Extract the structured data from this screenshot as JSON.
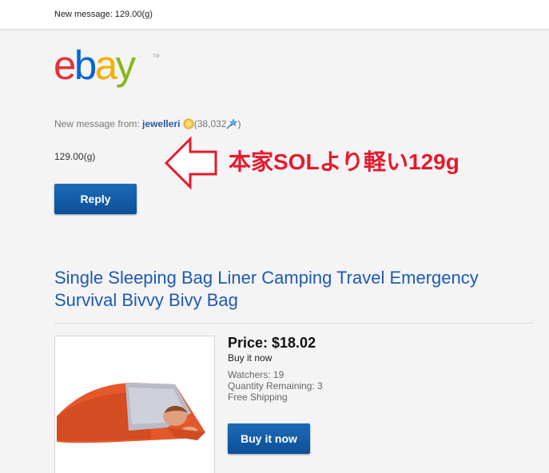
{
  "header": {
    "subject": "New message: 129.00(g)"
  },
  "logo": {
    "text_e": "e",
    "text_b": "b",
    "text_a": "a",
    "text_y": "y",
    "tm": "TM",
    "icon": "ebay-logo"
  },
  "message": {
    "from_label": "New message from:",
    "seller": "jewelleri",
    "feedback_open": "(38,032",
    "feedback_close": ")",
    "body": "129.00(g)",
    "reply_label": "Reply"
  },
  "annotation": {
    "text": "本家SOLより軽い129g",
    "color": "#e8192c",
    "icon": "left-arrow-outline"
  },
  "item": {
    "title": "Single Sleeping Bag Liner Camping Travel Emergency Survival Bivvy Bivy Bag",
    "price": "Price: $18.02",
    "format": "Buy it now",
    "watchers": "Watchers: 19",
    "quantity": "Quantity Remaining: 3",
    "shipping": "Free Shipping",
    "buy_label": "Buy it now"
  },
  "colors": {
    "accent_blue": "#0c4f99",
    "link_blue": "#1d5ab4",
    "background": "#f4f4f5"
  }
}
